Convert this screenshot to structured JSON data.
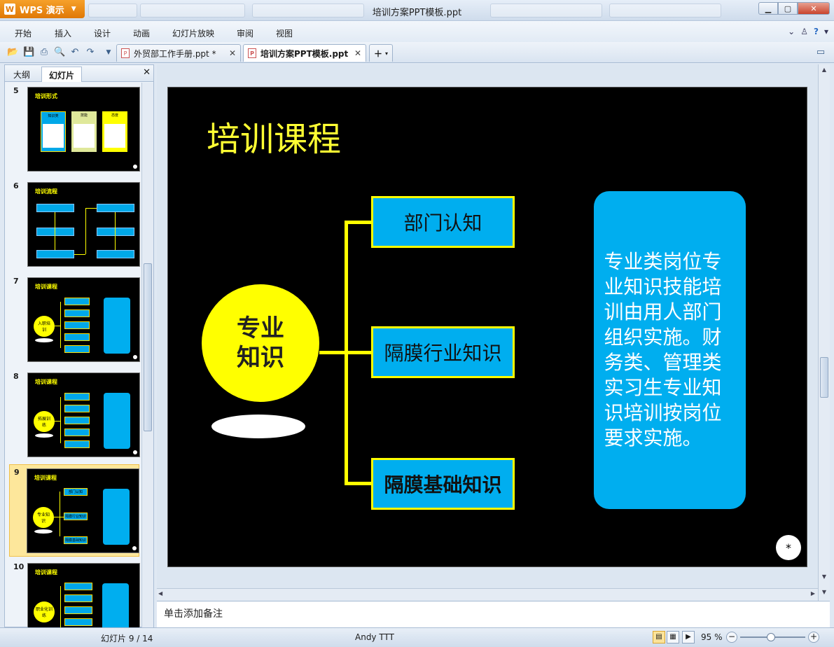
{
  "app": {
    "name": "WPS 演示",
    "window_title": "培训方案PPT模板.ppt"
  },
  "menu": [
    "开始",
    "插入",
    "设计",
    "动画",
    "幻灯片放映",
    "审阅",
    "视图"
  ],
  "doc_tabs": [
    {
      "label": "外贸部工作手册.ppt *"
    },
    {
      "label": "培训方案PPT模板.ppt"
    }
  ],
  "left_pane": {
    "tab_outline": "大纲",
    "tab_slides": "幻灯片",
    "thumbnails": [
      {
        "num": "5",
        "title": "培训形式",
        "boxes": [
          "知识类",
          "技能",
          "态度"
        ]
      },
      {
        "num": "6",
        "title": "培训流程"
      },
      {
        "num": "7",
        "title": "培训课程",
        "circle": "入职培训"
      },
      {
        "num": "8",
        "title": "培训课程",
        "circle": "拓展训练"
      },
      {
        "num": "9",
        "title": "培训课程",
        "circle": "专业知识",
        "items": [
          "部门认知",
          "隔膜行业知识",
          "隔膜基础知识"
        ]
      },
      {
        "num": "10",
        "title": "培训课程",
        "circle": "职业化训练"
      }
    ]
  },
  "slide": {
    "title": "培训课程",
    "circle_label": "专业知识",
    "branches": [
      "部门认知",
      "隔膜行业知识",
      "隔膜基础知识"
    ],
    "description": "专业类岗位专业知识技能培训由用人部门组织实施。财务类、管理类实习生专业知识培训按岗位要求实施。",
    "mark": "*"
  },
  "notes_placeholder": "单击添加备注",
  "status": {
    "slide_indicator": "幻灯片 9 / 14",
    "author": "Andy TTT",
    "zoom": "95 %"
  }
}
